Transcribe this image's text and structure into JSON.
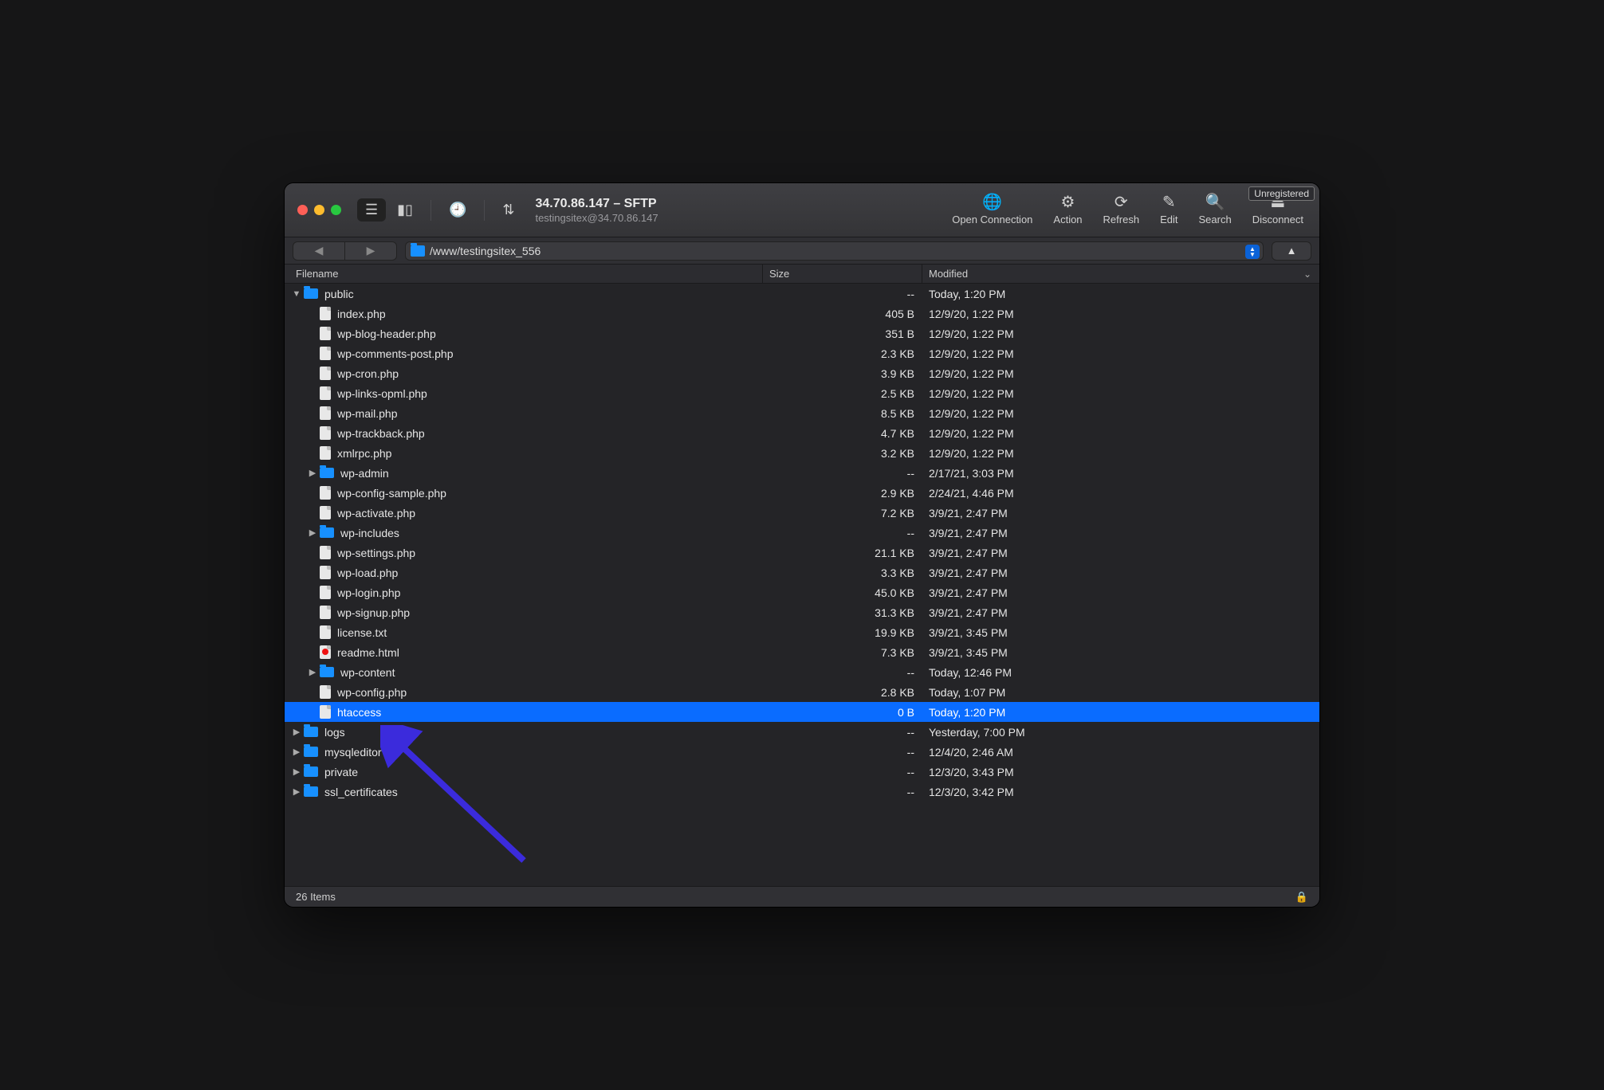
{
  "window": {
    "title": "34.70.86.147 – SFTP",
    "subtitle": "testingsitex@34.70.86.147",
    "unregistered": "Unregistered"
  },
  "toolbar": {
    "open_connection": "Open Connection",
    "action": "Action",
    "refresh": "Refresh",
    "edit": "Edit",
    "search": "Search",
    "disconnect": "Disconnect"
  },
  "path": "/www/testingsitex_556",
  "columns": {
    "filename": "Filename",
    "size": "Size",
    "modified": "Modified"
  },
  "rows": [
    {
      "type": "folder",
      "name": "public",
      "size": "--",
      "modified": "Today, 1:20 PM",
      "depth": 0,
      "expand": "down"
    },
    {
      "type": "file",
      "name": "index.php",
      "size": "405 B",
      "modified": "12/9/20, 1:22 PM",
      "depth": 1
    },
    {
      "type": "file",
      "name": "wp-blog-header.php",
      "size": "351 B",
      "modified": "12/9/20, 1:22 PM",
      "depth": 1
    },
    {
      "type": "file",
      "name": "wp-comments-post.php",
      "size": "2.3 KB",
      "modified": "12/9/20, 1:22 PM",
      "depth": 1
    },
    {
      "type": "file",
      "name": "wp-cron.php",
      "size": "3.9 KB",
      "modified": "12/9/20, 1:22 PM",
      "depth": 1
    },
    {
      "type": "file",
      "name": "wp-links-opml.php",
      "size": "2.5 KB",
      "modified": "12/9/20, 1:22 PM",
      "depth": 1
    },
    {
      "type": "file",
      "name": "wp-mail.php",
      "size": "8.5 KB",
      "modified": "12/9/20, 1:22 PM",
      "depth": 1
    },
    {
      "type": "file",
      "name": "wp-trackback.php",
      "size": "4.7 KB",
      "modified": "12/9/20, 1:22 PM",
      "depth": 1
    },
    {
      "type": "file",
      "name": "xmlrpc.php",
      "size": "3.2 KB",
      "modified": "12/9/20, 1:22 PM",
      "depth": 1
    },
    {
      "type": "folder",
      "name": "wp-admin",
      "size": "--",
      "modified": "2/17/21, 3:03 PM",
      "depth": 1,
      "expand": "right"
    },
    {
      "type": "file",
      "name": "wp-config-sample.php",
      "size": "2.9 KB",
      "modified": "2/24/21, 4:46 PM",
      "depth": 1
    },
    {
      "type": "file",
      "name": "wp-activate.php",
      "size": "7.2 KB",
      "modified": "3/9/21, 2:47 PM",
      "depth": 1
    },
    {
      "type": "folder",
      "name": "wp-includes",
      "size": "--",
      "modified": "3/9/21, 2:47 PM",
      "depth": 1,
      "expand": "right"
    },
    {
      "type": "file",
      "name": "wp-settings.php",
      "size": "21.1 KB",
      "modified": "3/9/21, 2:47 PM",
      "depth": 1
    },
    {
      "type": "file",
      "name": "wp-load.php",
      "size": "3.3 KB",
      "modified": "3/9/21, 2:47 PM",
      "depth": 1
    },
    {
      "type": "file",
      "name": "wp-login.php",
      "size": "45.0 KB",
      "modified": "3/9/21, 2:47 PM",
      "depth": 1
    },
    {
      "type": "file",
      "name": "wp-signup.php",
      "size": "31.3 KB",
      "modified": "3/9/21, 2:47 PM",
      "depth": 1
    },
    {
      "type": "file",
      "name": "license.txt",
      "size": "19.9 KB",
      "modified": "3/9/21, 3:45 PM",
      "depth": 1
    },
    {
      "type": "file",
      "name": "readme.html",
      "size": "7.3 KB",
      "modified": "3/9/21, 3:45 PM",
      "depth": 1,
      "variant": "html"
    },
    {
      "type": "folder",
      "name": "wp-content",
      "size": "--",
      "modified": "Today, 12:46 PM",
      "depth": 1,
      "expand": "right"
    },
    {
      "type": "file",
      "name": "wp-config.php",
      "size": "2.8 KB",
      "modified": "Today, 1:07 PM",
      "depth": 1
    },
    {
      "type": "file",
      "name": "htaccess",
      "size": "0 B",
      "modified": "Today, 1:20 PM",
      "depth": 1,
      "selected": true
    },
    {
      "type": "folder",
      "name": "logs",
      "size": "--",
      "modified": "Yesterday, 7:00 PM",
      "depth": 0,
      "expand": "right"
    },
    {
      "type": "folder",
      "name": "mysqleditor",
      "size": "--",
      "modified": "12/4/20, 2:46 AM",
      "depth": 0,
      "expand": "right"
    },
    {
      "type": "folder",
      "name": "private",
      "size": "--",
      "modified": "12/3/20, 3:43 PM",
      "depth": 0,
      "expand": "right"
    },
    {
      "type": "folder",
      "name": "ssl_certificates",
      "size": "--",
      "modified": "12/3/20, 3:42 PM",
      "depth": 0,
      "expand": "right"
    }
  ],
  "status": {
    "items": "26 Items"
  }
}
